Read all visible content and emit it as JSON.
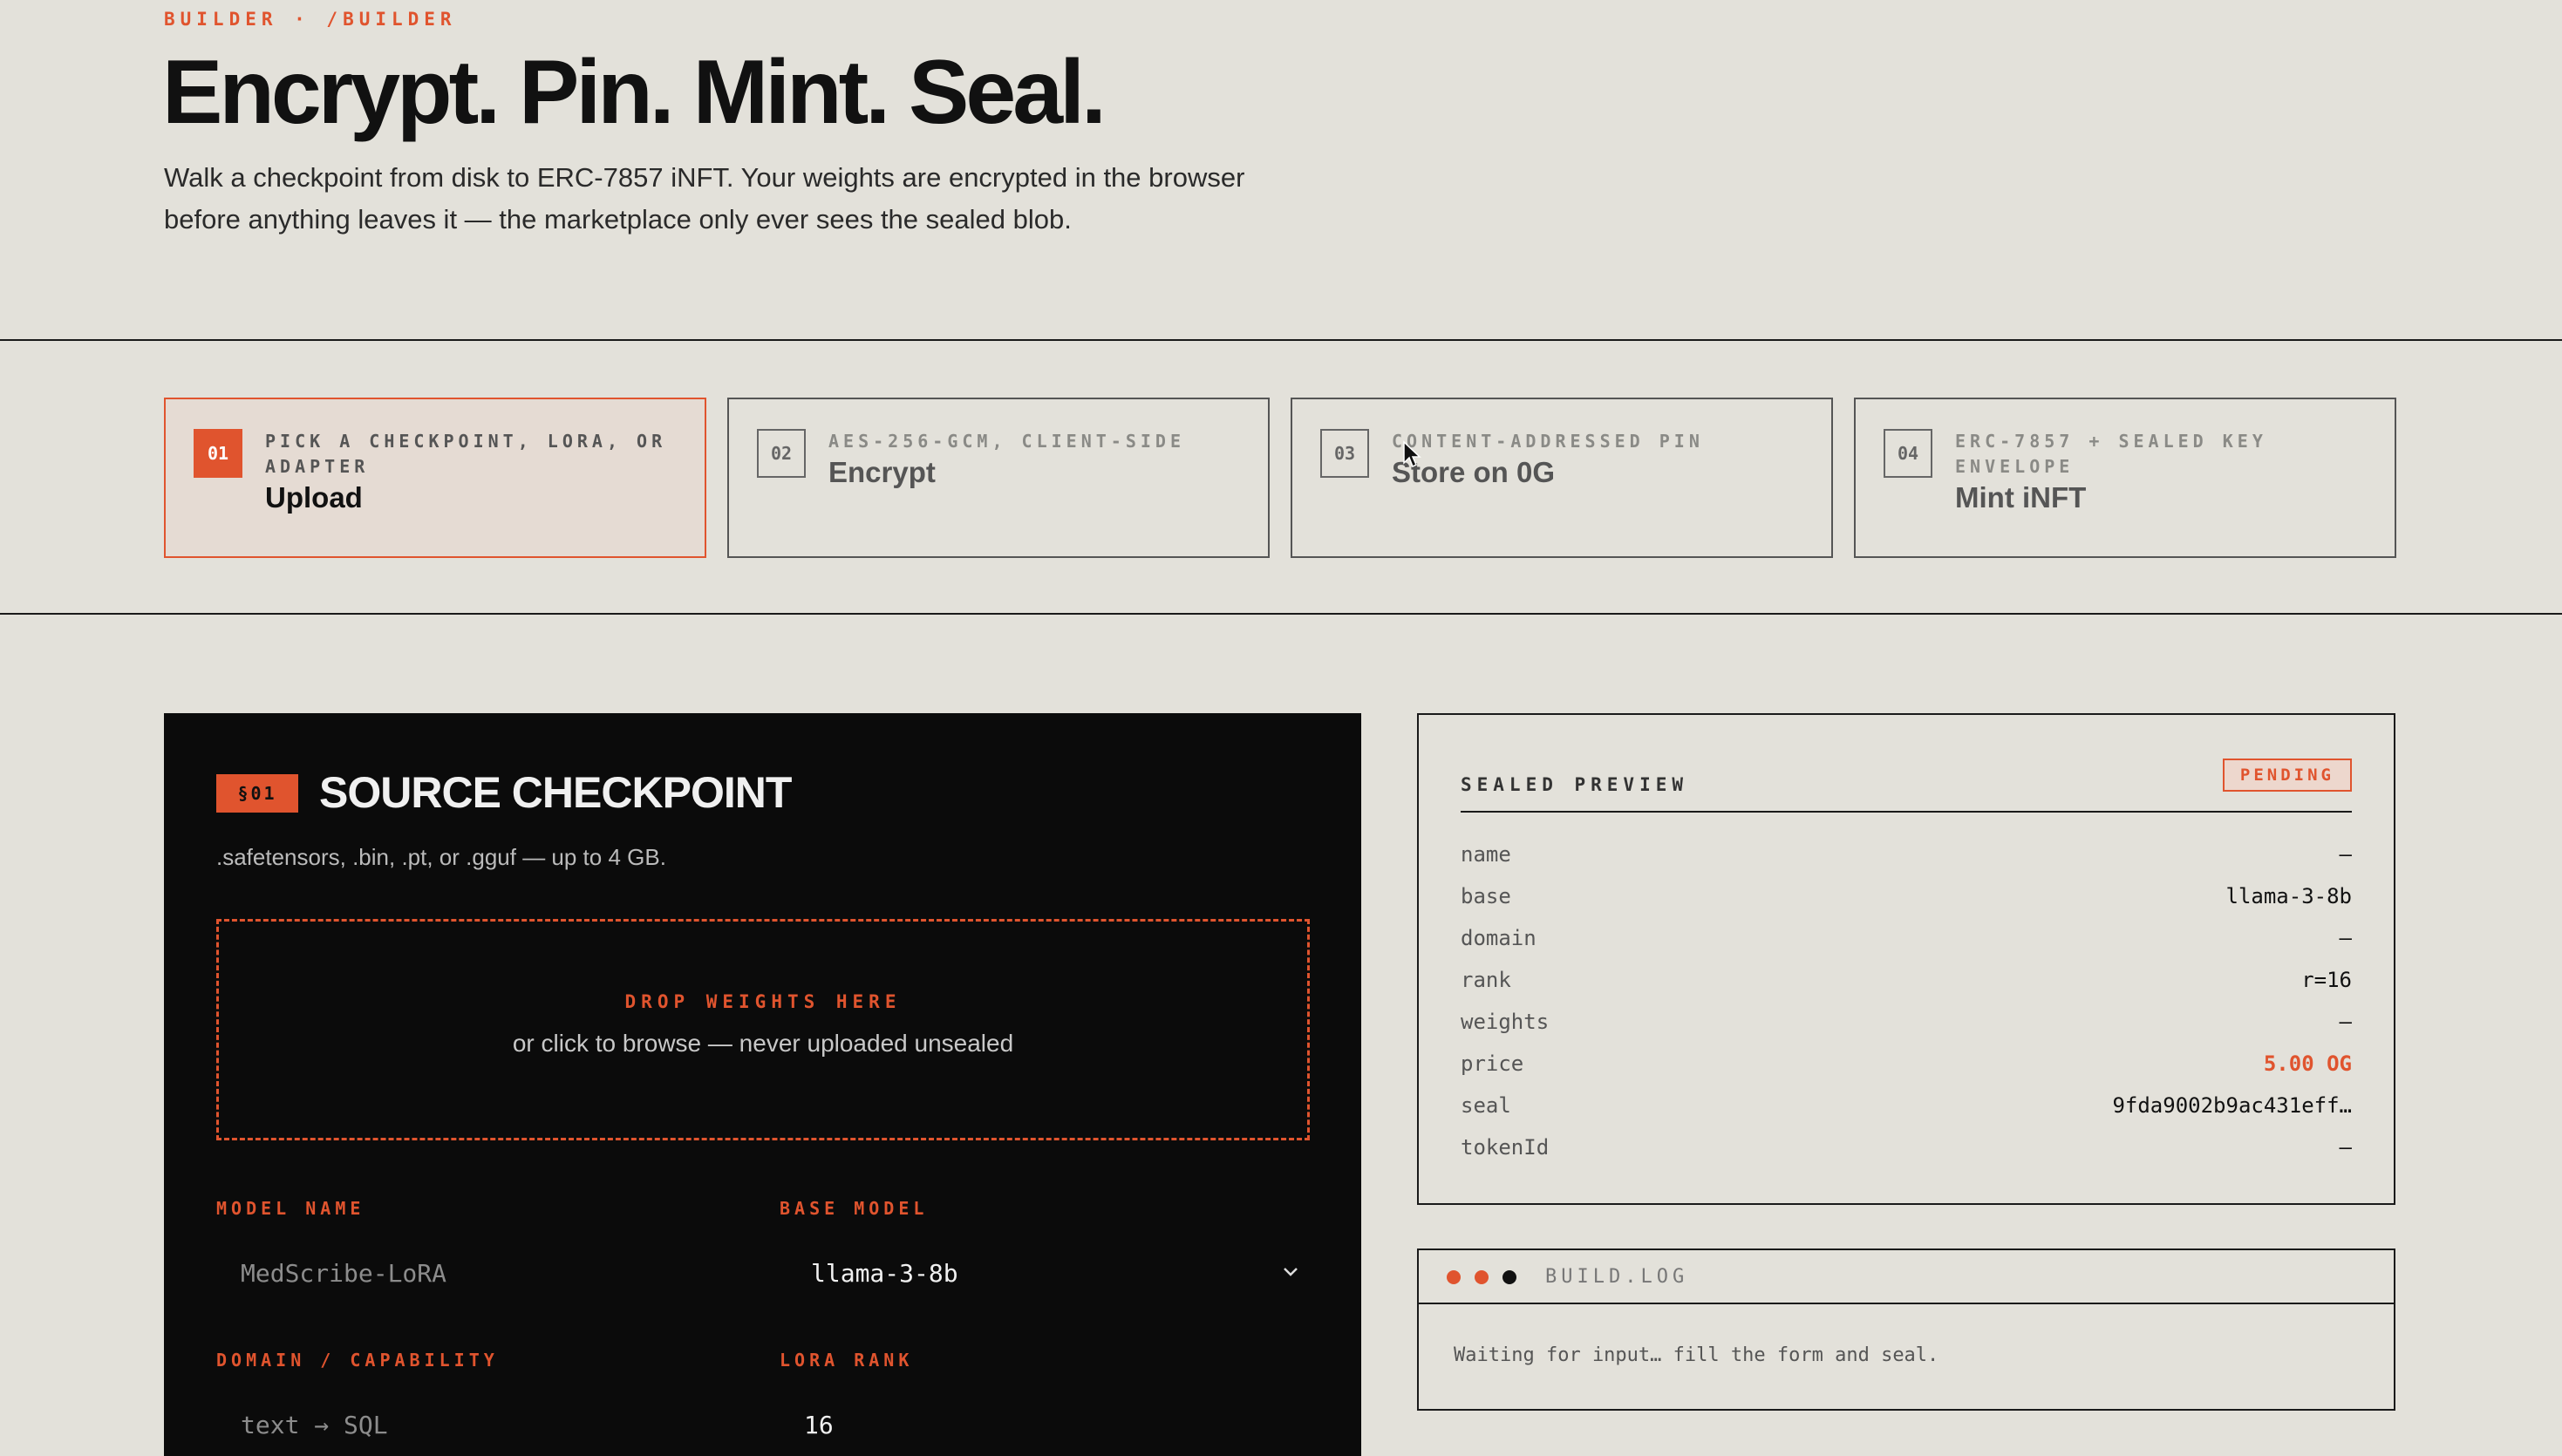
{
  "header": {
    "eyebrow": "BUILDER · /BUILDER",
    "title": "Encrypt. Pin. Mint. Seal.",
    "subtitle_line1": "Walk a checkpoint from disk to ERC-7857 iNFT. Your weights are encrypted in the browser",
    "subtitle_line2": "before anything leaves it — the marketplace only ever sees the sealed blob."
  },
  "steps": [
    {
      "num": "01",
      "caption": "PICK A CHECKPOINT, LORA, OR ADAPTER",
      "title": "Upload",
      "active": true
    },
    {
      "num": "02",
      "caption": "AES-256-GCM, CLIENT-SIDE",
      "title": "Encrypt",
      "active": false
    },
    {
      "num": "03",
      "caption": "CONTENT-ADDRESSED PIN",
      "title": "Store on 0G",
      "active": false
    },
    {
      "num": "04",
      "caption": "ERC-7857 + SEALED KEY ENVELOPE",
      "title": "Mint iNFT",
      "active": false
    }
  ],
  "source": {
    "badge": "§01",
    "title": "SOURCE CHECKPOINT",
    "description": ".safetensors, .bin, .pt, or .gguf — up to 4 GB.",
    "drop_title": "DROP WEIGHTS HERE",
    "drop_sub": "or click to browse — never uploaded unsealed",
    "model_name_label": "MODEL NAME",
    "model_name_placeholder": "MedScribe-LoRA",
    "base_model_label": "BASE MODEL",
    "base_model_value": "llama-3-8b",
    "domain_label": "DOMAIN / CAPABILITY",
    "domain_placeholder": "text → SQL",
    "lora_rank_label": "LORA RANK",
    "lora_rank_value": "16"
  },
  "preview": {
    "heading": "SEALED PREVIEW",
    "status": "PENDING",
    "rows": [
      {
        "key": "name",
        "value": "—"
      },
      {
        "key": "base",
        "value": "llama-3-8b"
      },
      {
        "key": "domain",
        "value": "—"
      },
      {
        "key": "rank",
        "value": "r=16"
      },
      {
        "key": "weights",
        "value": "—"
      },
      {
        "key": "price",
        "value": "5.00 OG"
      },
      {
        "key": "seal",
        "value": "9fda9002b9ac431eff…"
      },
      {
        "key": "tokenId",
        "value": "—"
      }
    ]
  },
  "log": {
    "title": "BUILD.LOG",
    "message": "Waiting for input… fill the form and seal."
  },
  "colors": {
    "accent": "#e0542e",
    "background": "#e3e1da",
    "card_dark": "#0b0b0b"
  }
}
